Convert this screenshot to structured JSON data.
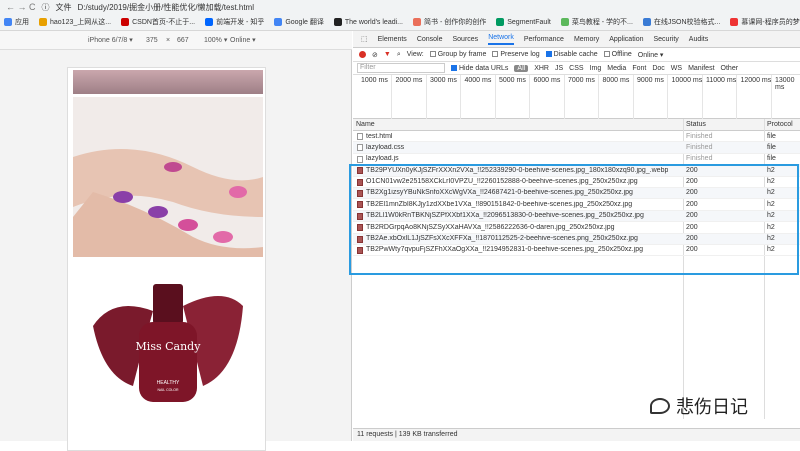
{
  "addressbar": {
    "nav_icons": "← → C",
    "info_icon": "ⓘ",
    "scheme_label": "文件",
    "url": "D:/study/2019/掘金小册/性能优化/懒加载/test.html"
  },
  "bookmarks": [
    {
      "label": "应用",
      "color": "#4285f4"
    },
    {
      "label": "hao123_上网从这...",
      "color": "#e8a000"
    },
    {
      "label": "CSDN首页-不止于...",
      "color": "#c00"
    },
    {
      "label": "前端开发 - 知乎",
      "color": "#0066ff"
    },
    {
      "label": "Google 翻译",
      "color": "#4285f4"
    },
    {
      "label": "The world's leadi...",
      "color": "#222"
    },
    {
      "label": "简书 - 创作你的创作",
      "color": "#ea6f5a"
    },
    {
      "label": "SegmentFault",
      "color": "#009a61"
    },
    {
      "label": "菜鸟教程 - 学的不...",
      "color": "#5cb85c"
    },
    {
      "label": "在线JSON校验格式...",
      "color": "#3a7bd5"
    },
    {
      "label": "慕课网-程序员的梦...",
      "color": "#e33"
    }
  ],
  "device_toolbar": {
    "device": "iPhone 6/7/8 ▾",
    "width": "375",
    "sep": "×",
    "height": "667",
    "zoom": "100% ▾",
    "network": "Online ▾"
  },
  "devtools": {
    "tabs": [
      "Elements",
      "Console",
      "Sources",
      "Network",
      "Performance",
      "Memory",
      "Application",
      "Security",
      "Audits"
    ],
    "active_tab": "Network",
    "toolbar": {
      "view_label": "View:",
      "group_label": "Group by frame",
      "preserve_label": "Preserve log",
      "disable_cache_label": "Disable cache",
      "offline_label": "Offline",
      "online_label": "Online ▾"
    },
    "filter": {
      "placeholder": "Filter",
      "hide_data_urls": "Hide data URLs",
      "types": [
        "All",
        "XHR",
        "JS",
        "CSS",
        "Img",
        "Media",
        "Font",
        "Doc",
        "WS",
        "Manifest",
        "Other"
      ]
    },
    "timeline_ticks": [
      "1000 ms",
      "2000 ms",
      "3000 ms",
      "4000 ms",
      "5000 ms",
      "6000 ms",
      "7000 ms",
      "8000 ms",
      "9000 ms",
      "10000 ms",
      "11000 ms",
      "12000 ms",
      "13000 ms"
    ],
    "columns": {
      "name": "Name",
      "status": "Status",
      "protocol": "Protocol"
    },
    "rows": [
      {
        "name": "test.html",
        "status": "Finished",
        "protocol": "file",
        "type": "doc"
      },
      {
        "name": "lazyload.css",
        "status": "Finished",
        "protocol": "file",
        "type": "doc"
      },
      {
        "name": "lazyload.js",
        "status": "Finished",
        "protocol": "file",
        "type": "doc"
      },
      {
        "name": "TB29PYUXn0yKJjSZFrXXXn2VXa_!!252339290-0-beehive-scenes.jpg_180x180xzq90.jpg_.webp",
        "status": "200",
        "protocol": "h2",
        "type": "img"
      },
      {
        "name": "O1CN01vw2e25158XCkLrI0VPZU_!!2260152888-0-beehive-scenes.jpg_250x250xz.jpg",
        "status": "200",
        "protocol": "h2",
        "type": "img"
      },
      {
        "name": "TB2Xg1izsyYBuNkSnfoXXcWgVXa_!!24687421-0-beehive-scenes.jpg_250x250xz.jpg",
        "status": "200",
        "protocol": "h2",
        "type": "img"
      },
      {
        "name": "TB2El1mnZbI8KJjy1zdXXbe1VXa_!!890151842-0-beehive-scenes.jpg_250x250xz.jpg",
        "status": "200",
        "protocol": "h2",
        "type": "img"
      },
      {
        "name": "TB2Ll1W0kRnTBKNjSZPfXXbf1XXa_!!2096513830-0-beehive-scenes.jpg_250x250xz.jpg",
        "status": "200",
        "protocol": "h2",
        "type": "img"
      },
      {
        "name": "TB2RDGrpqAo8KNjSZSyXXaHAVXa_!!2586222636-0-daren.jpg_250x250xz.jpg",
        "status": "200",
        "protocol": "h2",
        "type": "img"
      },
      {
        "name": "TB2Ae.xbOxlL1JjSZFsXXcXFFXa_!!1870112525-2-beehive-scenes.png_250x250xz.jpg",
        "status": "200",
        "protocol": "h2",
        "type": "img"
      },
      {
        "name": "TB2PwWty7qvpuFjSZFhXXaOgXXa_!!2194952831-0-beehive-scenes.jpg_250x250xz.jpg",
        "status": "200",
        "protocol": "h2",
        "type": "img"
      }
    ],
    "summary": "11 requests | 139 KB transferred"
  },
  "page_images": {
    "bottle_brand": "Miss Candy",
    "bottle_sub": "HEALTHY",
    "bottle_sub2": "NAIL COLOR"
  },
  "watermark": {
    "text": "悲伤日记"
  }
}
